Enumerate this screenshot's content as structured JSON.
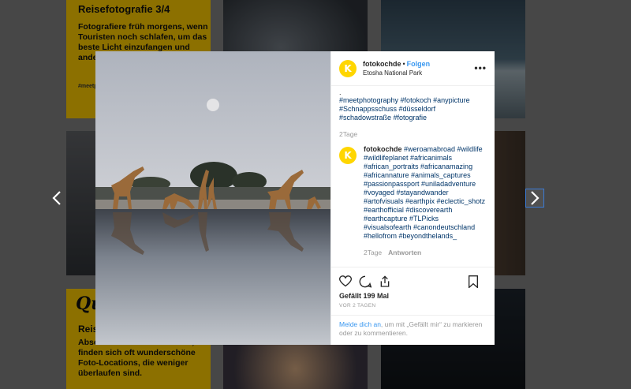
{
  "background": {
    "tile_top_left": {
      "title": "Reisefotografie 3/4",
      "body": "Fotografiere früh morgens, wenn Touristen noch schlafen, um das beste Licht einzufangen und andere",
      "tag": "#meetp"
    },
    "tile_bottom_left": {
      "script": "Qu",
      "heading": "Reise",
      "body": "Abse... z.B. auf einer Anhöhe, finden sich oft wunderschöne Foto-Locations, die weniger überlaufen sind."
    }
  },
  "post": {
    "username": "fotokochde",
    "avatar_letter": "K",
    "dot": "•",
    "follow_label": "Folgen",
    "location": "Etosha National Park",
    "more_label": "•••",
    "caption_dot": ".",
    "caption_tags": "#meetphotography #fotokoch #anypicture #Schnappsschuss #düsseldorf #schadowstraße #fotografie",
    "caption_time": "2Tage",
    "comment": {
      "username": "fotokochde",
      "text": "#weroamabroad #wildlife #wildlifeplanet #africanimals #african_portraits #africanamazing #africannature #animals_captures #passionpassport #uniladadventure #voyaged #stayandwander #artofvisuals #earthpix #eclectic_shotz #earthofficial #discoverearth #earthcapture #TLPicks #visualsofearth #canondeutschland #hellofrom #beyondthelands_",
      "time": "2Tage",
      "reply_label": "Antworten"
    },
    "likes": "Gefällt 199 Mal",
    "date": "VOR 2 TAGEN",
    "login_link": "Melde dich an",
    "login_text": ", um mit „Gefällt mir“ zu markieren oder zu kommentieren."
  },
  "colors": {
    "accent": "#3897f0",
    "avatar": "#ffd600",
    "tile_yellow": "#f2c200"
  },
  "icons": [
    "heart-icon",
    "comment-icon",
    "share-icon",
    "bookmark-icon",
    "chevron-left-icon",
    "chevron-right-icon"
  ]
}
